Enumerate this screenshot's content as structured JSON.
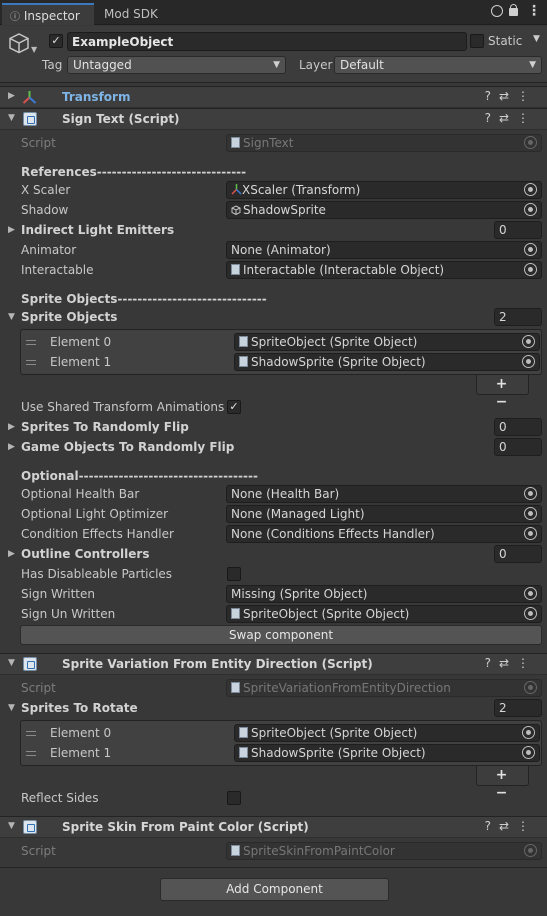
{
  "tabs": {
    "inspector": "Inspector",
    "mod_sdk": "Mod SDK"
  },
  "object": {
    "name": "ExampleObject",
    "static_label": "Static",
    "tag_label": "Tag",
    "tag_value": "Untagged",
    "layer_label": "Layer",
    "layer_value": "Default"
  },
  "transform": {
    "title": "Transform"
  },
  "sign_text": {
    "title": "Sign Text (Script)",
    "script_label": "Script",
    "script_value": "SignText",
    "references_header": "References------------------------------",
    "x_scaler_label": "X Scaler",
    "x_scaler_value": "XScaler (Transform)",
    "shadow_label": "Shadow",
    "shadow_value": "ShadowSprite",
    "indirect_label": "Indirect Light Emitters",
    "indirect_count": "0",
    "animator_label": "Animator",
    "animator_value": "None (Animator)",
    "interactable_label": "Interactable",
    "interactable_value": "Interactable (Interactable Object)",
    "sprite_objects_header": "Sprite Objects------------------------------",
    "sprite_objects_label": "Sprite Objects",
    "sprite_objects_count": "2",
    "elements": [
      {
        "label": "Element 0",
        "value": "SpriteObject (Sprite Object)"
      },
      {
        "label": "Element 1",
        "value": "ShadowSprite (Sprite Object)"
      }
    ],
    "plus_minus": "+ −",
    "use_shared_label": "Use Shared Transform Animations",
    "sprites_flip_label": "Sprites To Randomly Flip",
    "sprites_flip_count": "0",
    "go_flip_label": "Game Objects To Randomly Flip",
    "go_flip_count": "0",
    "optional_header": "Optional------------------------------------",
    "health_label": "Optional Health Bar",
    "health_value": "None (Health Bar)",
    "light_opt_label": "Optional Light Optimizer",
    "light_opt_value": "None (Managed Light)",
    "cond_label": "Condition Effects Handler",
    "cond_value": "None (Conditions Effects Handler)",
    "outline_label": "Outline Controllers",
    "outline_count": "0",
    "particles_label": "Has Disableable Particles",
    "sign_written_label": "Sign Written",
    "sign_written_value": "Missing (Sprite Object)",
    "sign_unwritten_label": "Sign Un Written",
    "sign_unwritten_value": "SpriteObject (Sprite Object)",
    "swap_button": "Swap component"
  },
  "sprite_variation": {
    "title": "Sprite Variation From Entity Direction (Script)",
    "script_label": "Script",
    "script_value": "SpriteVariationFromEntityDirection",
    "rotate_label": "Sprites To Rotate",
    "rotate_count": "2",
    "elements": [
      {
        "label": "Element 0",
        "value": "SpriteObject (Sprite Object)"
      },
      {
        "label": "Element 1",
        "value": "ShadowSprite (Sprite Object)"
      }
    ],
    "plus_minus": "+ −",
    "reflect_label": "Reflect Sides"
  },
  "sprite_skin": {
    "title": "Sprite Skin From Paint Color (Script)",
    "script_label": "Script",
    "script_value": "SpriteSkinFromPaintColor"
  },
  "add_component": "Add Component",
  "icons": {
    "menu": "⋮",
    "help": "?",
    "settings": "⇄",
    "lock": "🔒",
    "circle": "○"
  },
  "colors": {
    "accent": "#3a79bb",
    "transform_title": "#7eb4e6"
  }
}
